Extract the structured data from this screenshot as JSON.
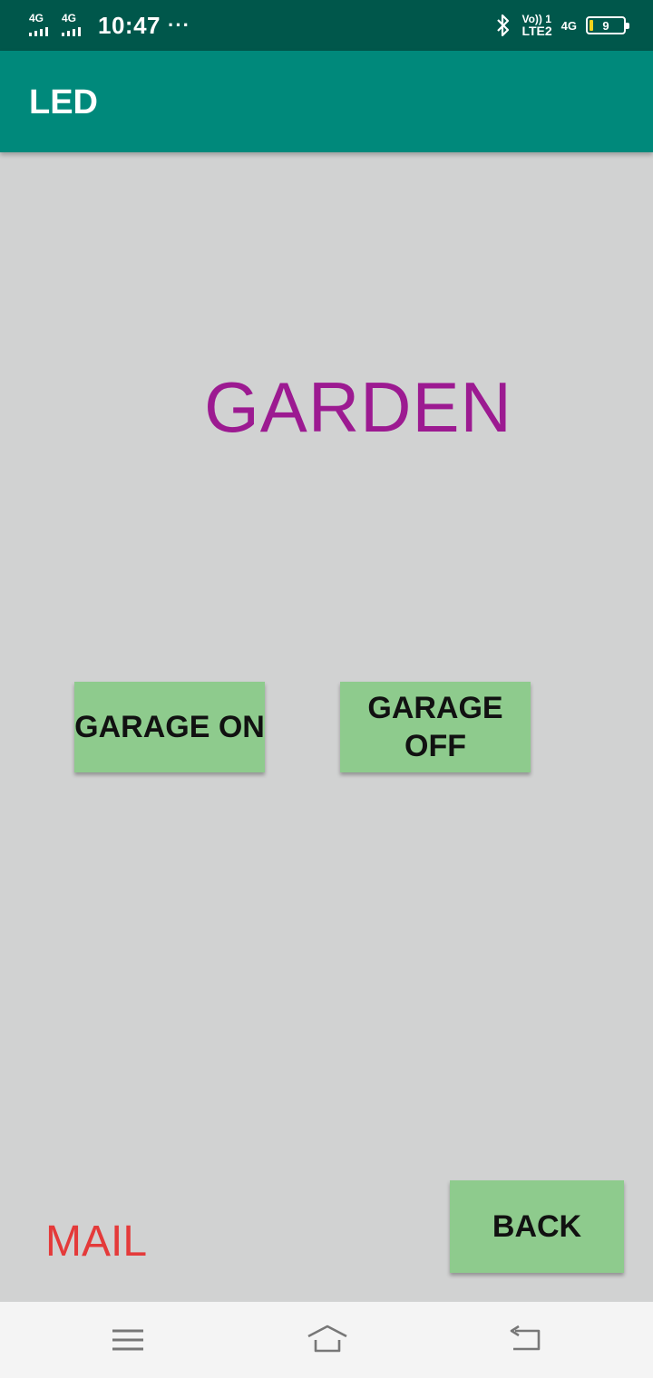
{
  "status_bar": {
    "sim1_network": "4G",
    "sim2_network": "4G",
    "time": "10:47",
    "more": "···",
    "volte_top": "Vo)) 1",
    "volte_bottom": "LTE2",
    "data_network": "4G",
    "battery_level": "9"
  },
  "app_bar": {
    "title": "LED"
  },
  "main": {
    "heading": "GARDEN",
    "garage_on_label": "GARAGE ON",
    "garage_off_label": "GARAGE OFF",
    "mail_label": "MAIL",
    "back_label": "BACK"
  },
  "colors": {
    "status_bar": "#00574b",
    "app_bar": "#00897b",
    "background": "#d1d2d2",
    "heading": "#9c1a91",
    "button": "#8ecb8d",
    "mail": "#e43a3a"
  },
  "nav_bar": {
    "icons": [
      "menu-icon",
      "home-icon",
      "back-icon"
    ]
  }
}
